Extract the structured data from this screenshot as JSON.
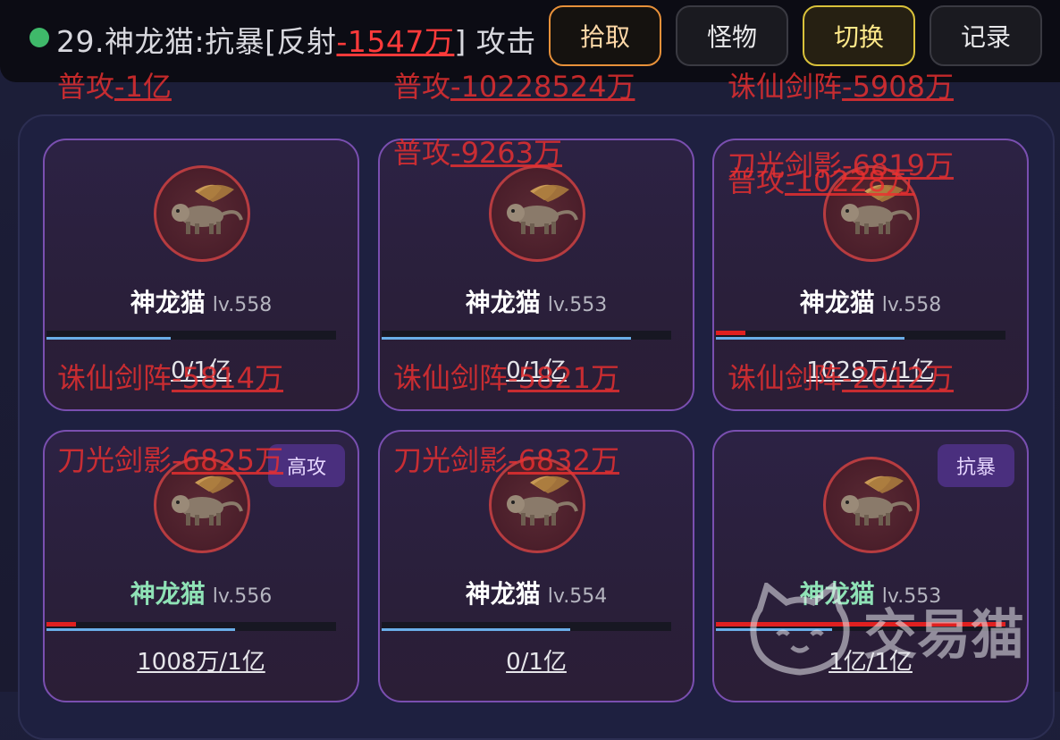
{
  "topbar": {
    "combat_prefix": "29.神龙猫:抗暴[反射",
    "combat_value": "-1547万",
    "combat_suffix": "] 攻击",
    "buttons": {
      "pickup": "拾取",
      "monster": "怪物",
      "switch": "切换",
      "log": "记录"
    }
  },
  "monsters": [
    {
      "name": "神龙猫",
      "level": "lv.558",
      "hp_text": "0/1亿",
      "progress": 0.43,
      "hp_ratio": 0,
      "name_color": "white",
      "tag": ""
    },
    {
      "name": "神龙猫",
      "level": "lv.553",
      "hp_text": "0/1亿",
      "progress": 0.86,
      "hp_ratio": 0,
      "name_color": "white",
      "tag": ""
    },
    {
      "name": "神龙猫",
      "level": "lv.558",
      "hp_text": "1028万/1亿",
      "progress": 0.65,
      "hp_ratio": 0.1028,
      "name_color": "white",
      "tag": ""
    },
    {
      "name": "神龙猫",
      "level": "lv.556",
      "hp_text": "1008万/1亿",
      "progress": 0.65,
      "hp_ratio": 0.1008,
      "name_color": "green",
      "tag": "高攻"
    },
    {
      "name": "神龙猫",
      "level": "lv.554",
      "hp_text": "0/1亿",
      "progress": 0.65,
      "hp_ratio": 0,
      "name_color": "white",
      "tag": ""
    },
    {
      "name": "神龙猫",
      "level": "lv.553",
      "hp_text": "1亿/1亿",
      "progress": 0.4,
      "hp_ratio": 1,
      "name_color": "green",
      "tag": "抗暴"
    }
  ],
  "floating_damage": [
    {
      "skill": "普攻",
      "value": "-1亿"
    },
    {
      "skill": "普攻",
      "value": "-10228524万"
    },
    {
      "skill": "诛仙剑阵",
      "value": "-5908万"
    },
    {
      "skill": "普攻",
      "value": "-9263万"
    },
    {
      "skill": "刀光剑影",
      "value": "-6819万"
    },
    {
      "skill": "普攻",
      "value": "-10228万"
    },
    {
      "skill": "诛仙剑阵",
      "value": "-5814万"
    },
    {
      "skill": "诛仙剑阵",
      "value": "-5821万"
    },
    {
      "skill": "诛仙剑阵",
      "value": "-2012万"
    },
    {
      "skill": "刀光剑影",
      "value": "-6825万"
    },
    {
      "skill": "刀光剑影",
      "value": "-6832万"
    }
  ],
  "watermark": {
    "text": "交易猫"
  },
  "colors": {
    "damage": "#eb3030",
    "accent_orange": "#e8913a",
    "accent_gold": "#d9c13a",
    "card_border": "#7a4fb0"
  }
}
